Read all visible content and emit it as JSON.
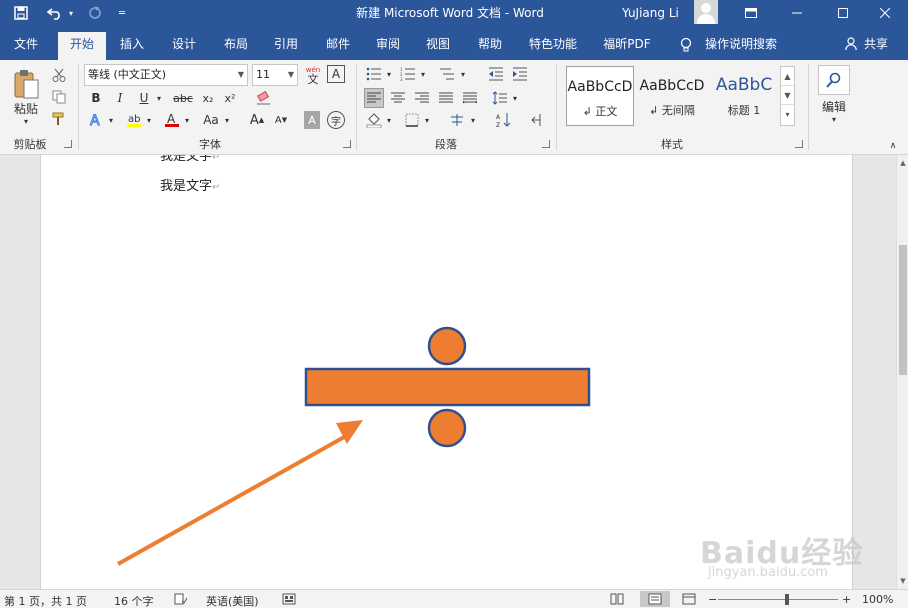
{
  "titlebar": {
    "title": "新建 Microsoft Word 文档  -  Word",
    "user": "YuJiang Li",
    "bg_color": "#2b579a",
    "quick_access": [
      "save-icon",
      "undo-icon",
      "redo-icon",
      "customize-icon"
    ],
    "window_buttons": [
      "ribbon-display-icon",
      "minimize-icon",
      "maximize-icon",
      "close-icon"
    ]
  },
  "tabs": {
    "items": [
      "文件",
      "开始",
      "插入",
      "设计",
      "布局",
      "引用",
      "邮件",
      "审阅",
      "视图",
      "帮助",
      "特色功能",
      "福昕PDF"
    ],
    "active": "开始",
    "tell_me": "操作说明搜索",
    "share": "共享"
  },
  "ribbon": {
    "clipboard": {
      "paste": "粘贴",
      "label": "剪贴板"
    },
    "font": {
      "name": "等线 (中文正文)",
      "size": "11",
      "label": "字体",
      "bold": "B",
      "italic": "I",
      "underline": "U",
      "strike": "abc",
      "subscript": "x₂",
      "superscript": "x²",
      "change_case": "Aa",
      "grow": "A",
      "shrink": "A",
      "phonetic": "wén",
      "border_char": "A",
      "enclose": "字",
      "shade": "A"
    },
    "paragraph": {
      "label": "段落"
    },
    "styles": {
      "label": "样式",
      "items": [
        {
          "preview": "AaBbCcD",
          "name": "正文"
        },
        {
          "preview": "AaBbCcD",
          "name": "无间隔"
        },
        {
          "preview": "AaBbC",
          "name": "标题 1"
        }
      ]
    },
    "editing": {
      "label": "编辑"
    }
  },
  "document": {
    "lines": [
      "我是文字",
      "我是文字"
    ],
    "shape_color": "#ed7d31",
    "shape_border": "#2f528f",
    "arrow_color": "#ed7d31"
  },
  "statusbar": {
    "page": "第 1 页，共 1 页",
    "words": "16 个字",
    "language": "英语(美国)",
    "zoom": "100%",
    "zoom_minus": "−",
    "zoom_plus": "+"
  },
  "watermark": {
    "brand": "Baidu经验",
    "url": "jingyan.baidu.com"
  }
}
